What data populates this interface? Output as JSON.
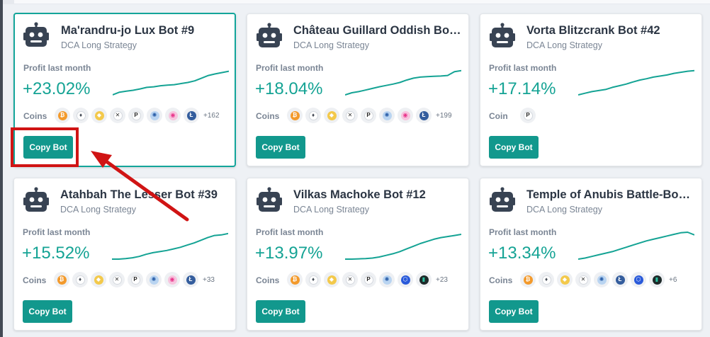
{
  "colors": {
    "accent": "#14a394",
    "button": "#12988d",
    "highlight": "#d01414",
    "title": "#2b3543"
  },
  "cards": [
    {
      "title": "Ma'randru-jo Lux Bot #9",
      "subtitle": "DCA Long Strategy",
      "profit_label": "Profit last month",
      "profit": "+23.02%",
      "coins_label": "Coins",
      "coins": [
        "btc-icon",
        "eth-icon",
        "bnb-icon",
        "xrp-icon",
        "dot-icon",
        "ada-icon",
        "uni-icon",
        "ltc-icon"
      ],
      "more": "+162",
      "button": "Copy Bot",
      "spark": [
        0.0,
        0.1,
        0.14,
        0.17,
        0.22,
        0.28,
        0.3,
        0.34,
        0.36,
        0.38,
        0.42,
        0.46,
        0.52,
        0.62,
        0.72,
        0.78,
        0.83,
        0.88
      ]
    },
    {
      "title": "Château Guillard Oddish Bo…",
      "subtitle": "DCA Long Strategy",
      "profit_label": "Profit last month",
      "profit": "+18.04%",
      "coins_label": "Coins",
      "coins": [
        "btc-icon",
        "eth-icon",
        "bnb-icon",
        "xrp-icon",
        "dot-icon",
        "ada-icon",
        "uni-icon",
        "ltc-icon"
      ],
      "more": "+199",
      "button": "Copy Bot",
      "spark": [
        0.0,
        0.08,
        0.12,
        0.18,
        0.24,
        0.3,
        0.35,
        0.4,
        0.46,
        0.55,
        0.62,
        0.66,
        0.68,
        0.69,
        0.7,
        0.72,
        0.86,
        0.9
      ]
    },
    {
      "title": "Vorta Blitzcrank Bot #42",
      "subtitle": "DCA Long Strategy",
      "profit_label": "Profit last month",
      "profit": "+17.14%",
      "coins_label": "Coin",
      "coins": [
        "dot-icon"
      ],
      "more": "",
      "button": "Copy Bot",
      "spark": [
        0.0,
        0.06,
        0.12,
        0.16,
        0.2,
        0.28,
        0.34,
        0.4,
        0.48,
        0.55,
        0.6,
        0.66,
        0.7,
        0.74,
        0.8,
        0.84,
        0.88,
        0.9
      ]
    },
    {
      "title": "Atahbah The Lesser Bot #39",
      "subtitle": "DCA Long Strategy",
      "profit_label": "Profit last month",
      "profit": "+15.52%",
      "coins_label": "Coins",
      "coins": [
        "btc-icon",
        "eth-icon",
        "bnb-icon",
        "xrp-icon",
        "dot-icon",
        "ada-icon",
        "uni-icon",
        "ltc-icon"
      ],
      "more": "+33",
      "button": "Copy Bot",
      "spark": [
        0.0,
        0.0,
        0.02,
        0.05,
        0.1,
        0.18,
        0.24,
        0.28,
        0.32,
        0.38,
        0.44,
        0.52,
        0.6,
        0.7,
        0.8,
        0.88,
        0.9,
        0.95
      ]
    },
    {
      "title": "Vilkas Machoke Bot #12",
      "subtitle": "DCA Long Strategy",
      "profit_label": "Profit last month",
      "profit": "+13.97%",
      "coins_label": "Coins",
      "coins": [
        "btc-icon",
        "eth-icon",
        "bnb-icon",
        "xrp-icon",
        "dot-icon",
        "ada-icon",
        "link-icon",
        "hbar-icon"
      ],
      "more": "+23",
      "button": "Copy Bot",
      "spark": [
        0.0,
        0.0,
        0.01,
        0.02,
        0.04,
        0.08,
        0.14,
        0.2,
        0.28,
        0.38,
        0.48,
        0.58,
        0.66,
        0.74,
        0.8,
        0.84,
        0.88,
        0.92
      ]
    },
    {
      "title": "Temple of Anubis Battle-Bo…",
      "subtitle": "DCA Long Strategy",
      "profit_label": "Profit last month",
      "profit": "+13.34%",
      "coins_label": "Coins",
      "coins": [
        "btc-icon",
        "eth-icon",
        "bnb-icon",
        "xrp-icon",
        "ada-icon",
        "ltc-icon",
        "link-icon",
        "hbar-icon"
      ],
      "more": "+6",
      "button": "Copy Bot",
      "spark": [
        0.0,
        0.04,
        0.1,
        0.16,
        0.22,
        0.28,
        0.36,
        0.44,
        0.52,
        0.6,
        0.68,
        0.74,
        0.8,
        0.86,
        0.92,
        0.98,
        1.0,
        0.9
      ]
    }
  ]
}
